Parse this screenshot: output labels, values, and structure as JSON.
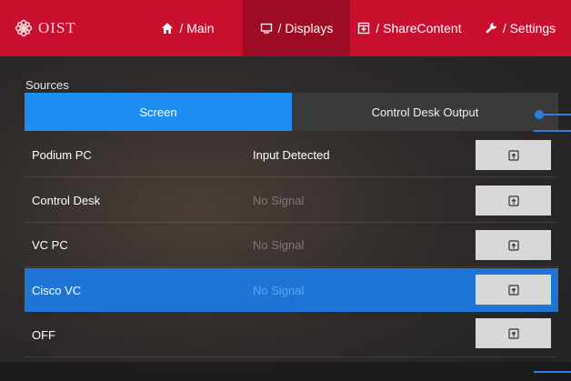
{
  "nav": {
    "logo_text": "OIST",
    "items": [
      {
        "icon": "home-icon",
        "label": "/ Main"
      },
      {
        "icon": "display-icon",
        "label": "/ Displays"
      },
      {
        "icon": "share-icon",
        "label": "/ ShareContent"
      },
      {
        "icon": "wrench-icon",
        "label": "/ Settings"
      }
    ],
    "active_index": 1
  },
  "sources": {
    "label": "Sources",
    "tabs": [
      "Screen",
      "Control Desk Output"
    ],
    "active_tab": 0,
    "rows": [
      {
        "name": "Podium PC",
        "status": "Input Detected",
        "signal": true
      },
      {
        "name": "Control Desk",
        "status": "No Signal",
        "signal": false
      },
      {
        "name": "VC PC",
        "status": "No Signal",
        "signal": false
      },
      {
        "name": "Cisco VC",
        "status": "No Signal",
        "signal": false,
        "selected": true
      },
      {
        "name": "OFF",
        "status": "",
        "signal": false
      }
    ]
  },
  "colors": {
    "brand": "#c8102e",
    "accent": "#1e8df0"
  }
}
